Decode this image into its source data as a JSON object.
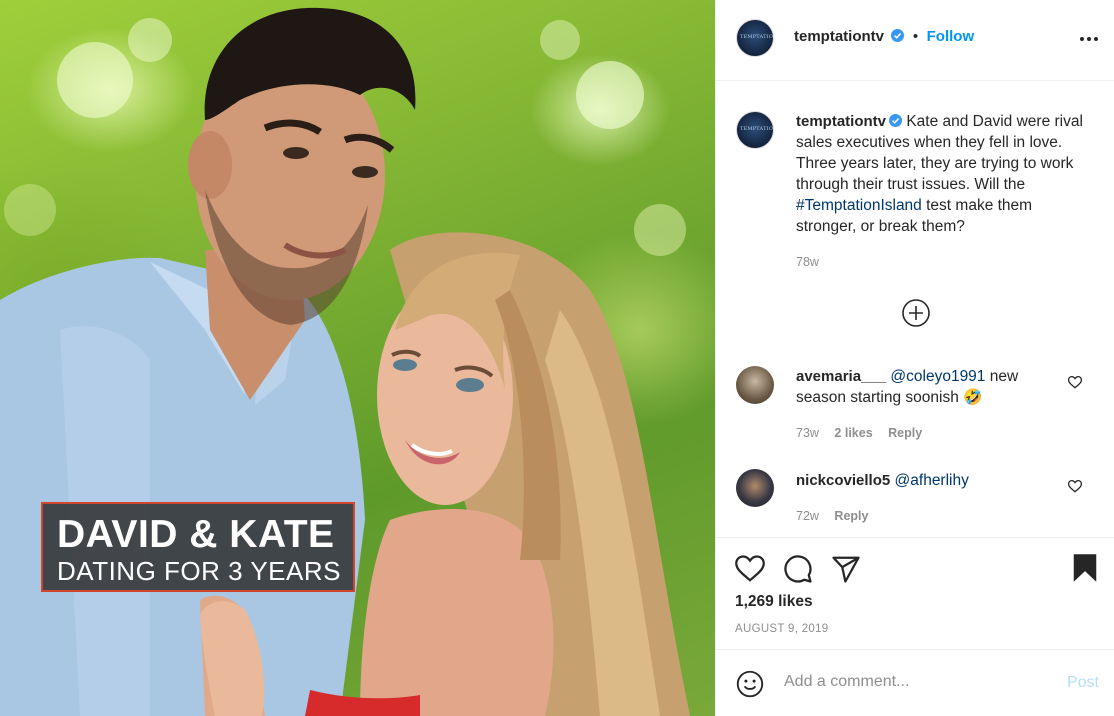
{
  "photo": {
    "overlay_title": "DAVID & KATE",
    "overlay_subtitle": "DATING FOR 3 YEARS"
  },
  "header": {
    "username": "temptationtv",
    "separator": "•",
    "follow_label": "Follow",
    "avatar_text": "TEMPTATION"
  },
  "caption": {
    "username": "temptationtv",
    "text_before": "Kate and David were rival sales executives when they fell in love. Three years later, they are trying to work through their trust issues. Will the ",
    "hashtag": "#TemptationIsland",
    "text_after": " test make them stronger, or break them?",
    "time": "78w"
  },
  "comments": [
    {
      "username": "avemaria___",
      "mention": "@coleyo1991",
      "text": " new season starting soonish 🤣",
      "time": "73w",
      "likes": "2 likes",
      "reply": "Reply"
    },
    {
      "username": "nickcoviello5",
      "mention": "@afherlihy",
      "text": "",
      "time": "72w",
      "reply": "Reply"
    }
  ],
  "actions": {
    "likes": "1,269 likes",
    "date": "AUGUST 9, 2019"
  },
  "comment_box": {
    "placeholder": "Add a comment...",
    "post_label": "Post"
  },
  "colors": {
    "accent": "#0095f6",
    "link": "#00376b",
    "muted": "#8e8e8e",
    "post_disabled": "#b2dffc",
    "overlay_border": "#d0452b"
  },
  "icons": [
    "verified-badge-icon",
    "more-options-icon",
    "load-more-icon",
    "heart-icon",
    "comment-icon",
    "share-icon",
    "bookmark-icon",
    "emoji-icon"
  ]
}
